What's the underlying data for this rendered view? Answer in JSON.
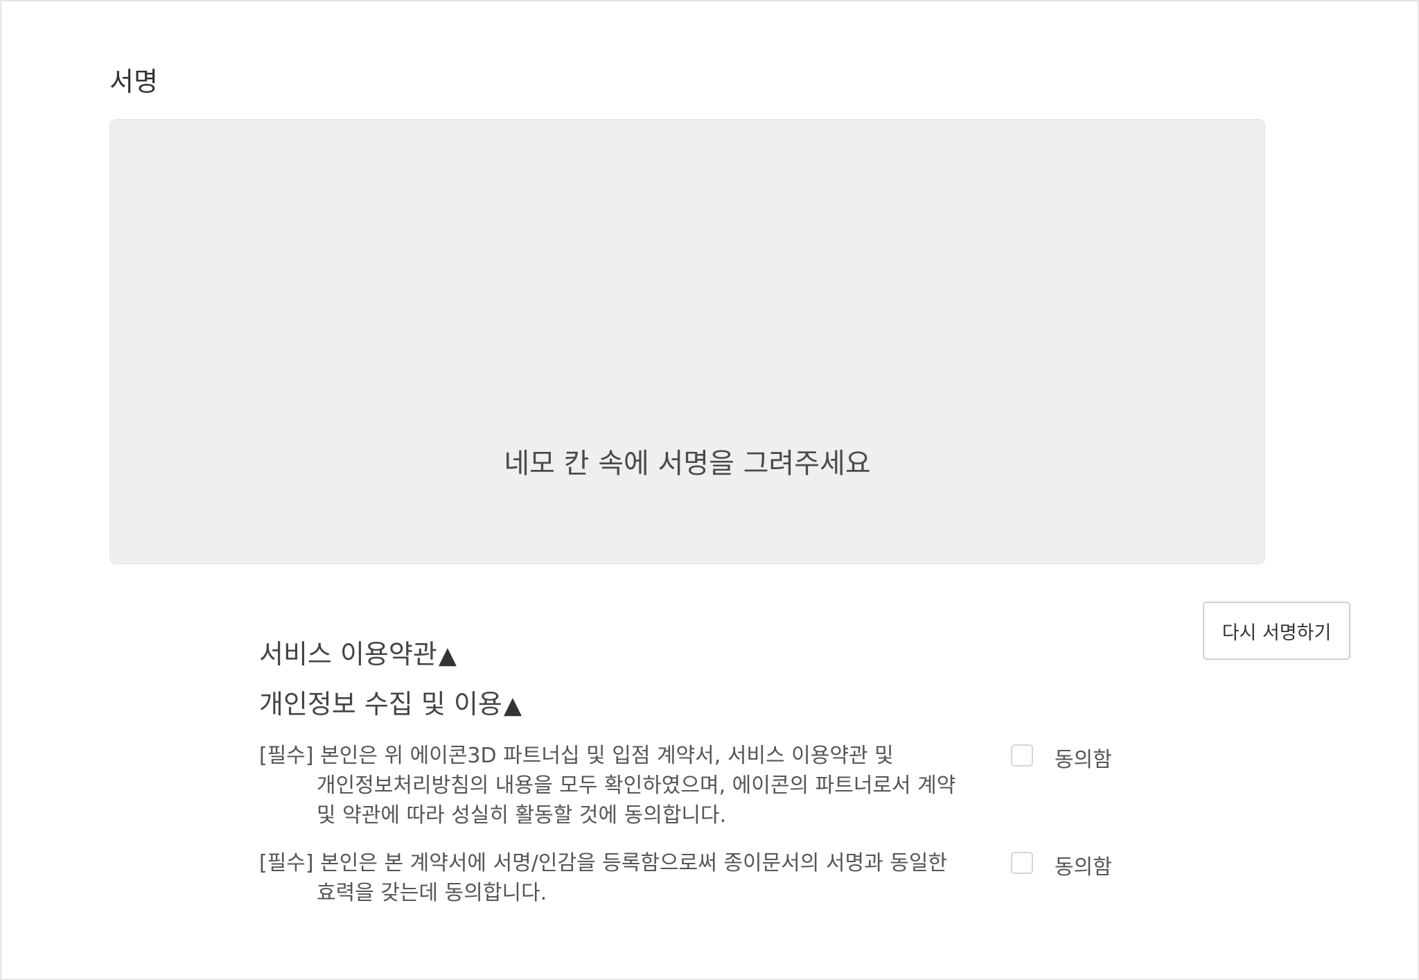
{
  "signature": {
    "title": "서명",
    "hint": "네모 칸 속에 서명을 그려주세요",
    "resign_button": "다시 서명하기"
  },
  "sections": {
    "terms_link": "서비스 이용약관",
    "privacy_link": "개인정보 수집 및 이용",
    "toggle_icon": "▲"
  },
  "agreements": [
    {
      "tag": "[필수]",
      "line1": "본인은 위 에이콘3D 파트너십 및 입점 계약서, 서비스 이용약관 및",
      "line2": "개인정보처리방침의 내용을 모두 확인하였으며, 에이콘의 파트너로서 계약",
      "line3": "및 약관에 따라 성실히 활동할 것에 동의합니다.",
      "checkbox_label": "동의함",
      "checked": false
    },
    {
      "tag": "[필수]",
      "line1": "본인은 본 계약서에 서명/인감을 등록함으로써 종이문서의 서명과 동일한",
      "line2": "효력을 갖는데 동의합니다.",
      "checkbox_label": "동의함",
      "checked": false
    }
  ]
}
